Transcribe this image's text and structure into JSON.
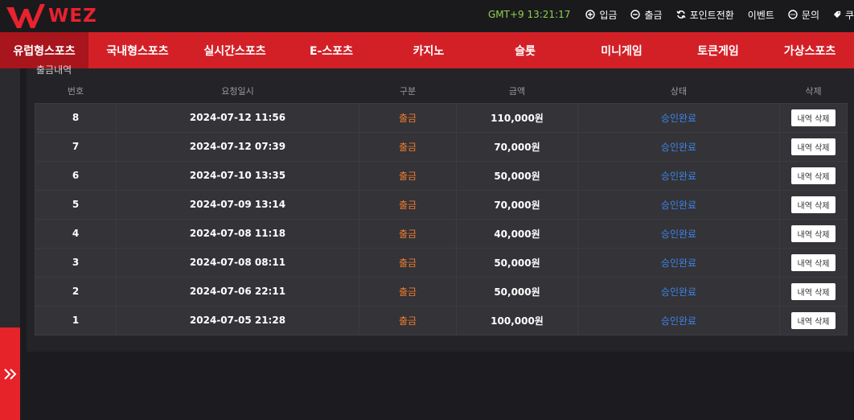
{
  "header": {
    "logo_text": "WEZ",
    "clock": "GMT+9 13:21:17",
    "links": [
      {
        "label": "입금",
        "icon": "plus-circle-icon"
      },
      {
        "label": "출금",
        "icon": "minus-circle-icon"
      },
      {
        "label": "포인트전환",
        "icon": "refresh-icon"
      },
      {
        "label": "이벤트",
        "icon": ""
      },
      {
        "label": "문의",
        "icon": "chat-icon"
      },
      {
        "label": "쿠",
        "icon": "tag-icon"
      }
    ]
  },
  "nav": {
    "items": [
      "유럽형스포츠",
      "국내형스포츠",
      "실시간스포츠",
      "E-스포츠",
      "카지노",
      "슬롯",
      "미니게임",
      "토큰게임",
      "가상스포츠"
    ],
    "active_index": 0
  },
  "section": {
    "title_partial": "출금내역"
  },
  "table": {
    "headers": [
      "번호",
      "요청일시",
      "구분",
      "금액",
      "상태",
      "삭제"
    ],
    "delete_label": "내역 삭제",
    "rows": [
      {
        "no": "8",
        "date": "2024-07-12 11:56",
        "type": "출금",
        "amount": "110,000원",
        "status": "승인완료"
      },
      {
        "no": "7",
        "date": "2024-07-12 07:39",
        "type": "출금",
        "amount": "70,000원",
        "status": "승인완료"
      },
      {
        "no": "6",
        "date": "2024-07-10 13:35",
        "type": "출금",
        "amount": "50,000원",
        "status": "승인완료"
      },
      {
        "no": "5",
        "date": "2024-07-09 13:14",
        "type": "출금",
        "amount": "70,000원",
        "status": "승인완료"
      },
      {
        "no": "4",
        "date": "2024-07-08 11:18",
        "type": "출금",
        "amount": "40,000원",
        "status": "승인완료"
      },
      {
        "no": "3",
        "date": "2024-07-08 08:11",
        "type": "출금",
        "amount": "50,000원",
        "status": "승인완료"
      },
      {
        "no": "2",
        "date": "2024-07-06 22:11",
        "type": "출금",
        "amount": "50,000원",
        "status": "승인완료"
      },
      {
        "no": "1",
        "date": "2024-07-05 21:28",
        "type": "출금",
        "amount": "100,000원",
        "status": "승인완료"
      }
    ]
  },
  "colors": {
    "brand_red": "#d32027",
    "clock_green": "#8fd14f",
    "type_orange": "#f07a2a",
    "status_blue": "#3f84e5"
  }
}
